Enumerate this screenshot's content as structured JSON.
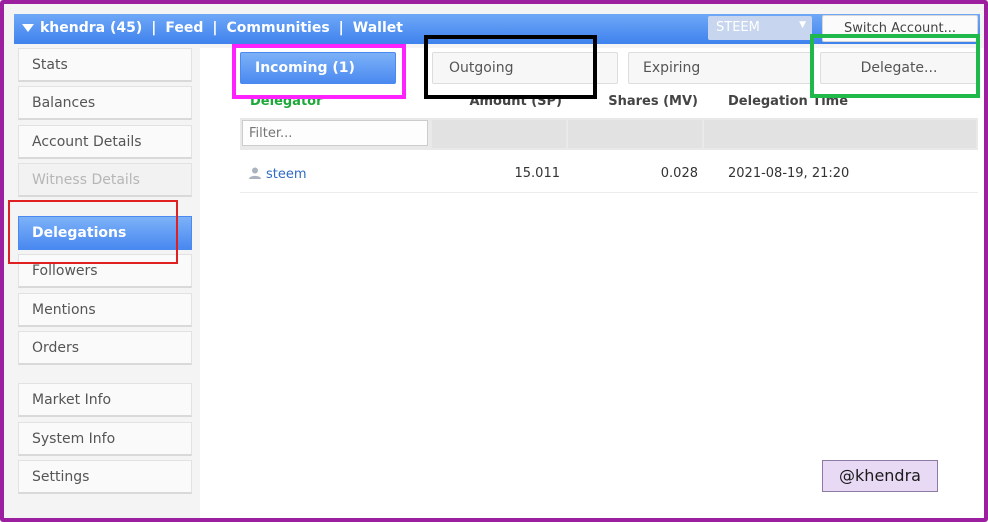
{
  "topbar": {
    "account": "khendra (45)",
    "links": [
      "Feed",
      "Communities",
      "Wallet"
    ],
    "currency": "STEEM",
    "switch_label": "Switch Account..."
  },
  "sidebar": {
    "items": [
      {
        "label": "Stats"
      },
      {
        "label": "Balances"
      },
      {
        "label": "Account Details"
      },
      {
        "label": "Witness Details"
      },
      {
        "label": "Delegations"
      },
      {
        "label": "Followers"
      },
      {
        "label": "Mentions"
      },
      {
        "label": "Orders"
      },
      {
        "label": "Market Info"
      },
      {
        "label": "System Info"
      },
      {
        "label": "Settings"
      }
    ]
  },
  "tabs": {
    "incoming": "Incoming (1)",
    "outgoing": "Outgoing",
    "expiring": "Expiring",
    "delegate": "Delegate..."
  },
  "table": {
    "headers": [
      "Delegator",
      "Amount (SP)",
      "Shares (MV)",
      "Delegation Time"
    ],
    "filter_placeholder": "Filter...",
    "rows": [
      {
        "delegator": "steem",
        "amount": "15.011",
        "shares": "0.028",
        "time": "2021-08-19, 21:20"
      }
    ]
  },
  "annotation": {
    "handle": "@khendra"
  },
  "colors": {
    "accent_blue": "#4a89f0",
    "delegator_green": "#1fa83a",
    "highlight_magenta": "#ff22ff",
    "highlight_black": "#000000",
    "highlight_green": "#1fb84a",
    "highlight_red": "#e02020",
    "frame_purple": "#9b1f9e"
  }
}
